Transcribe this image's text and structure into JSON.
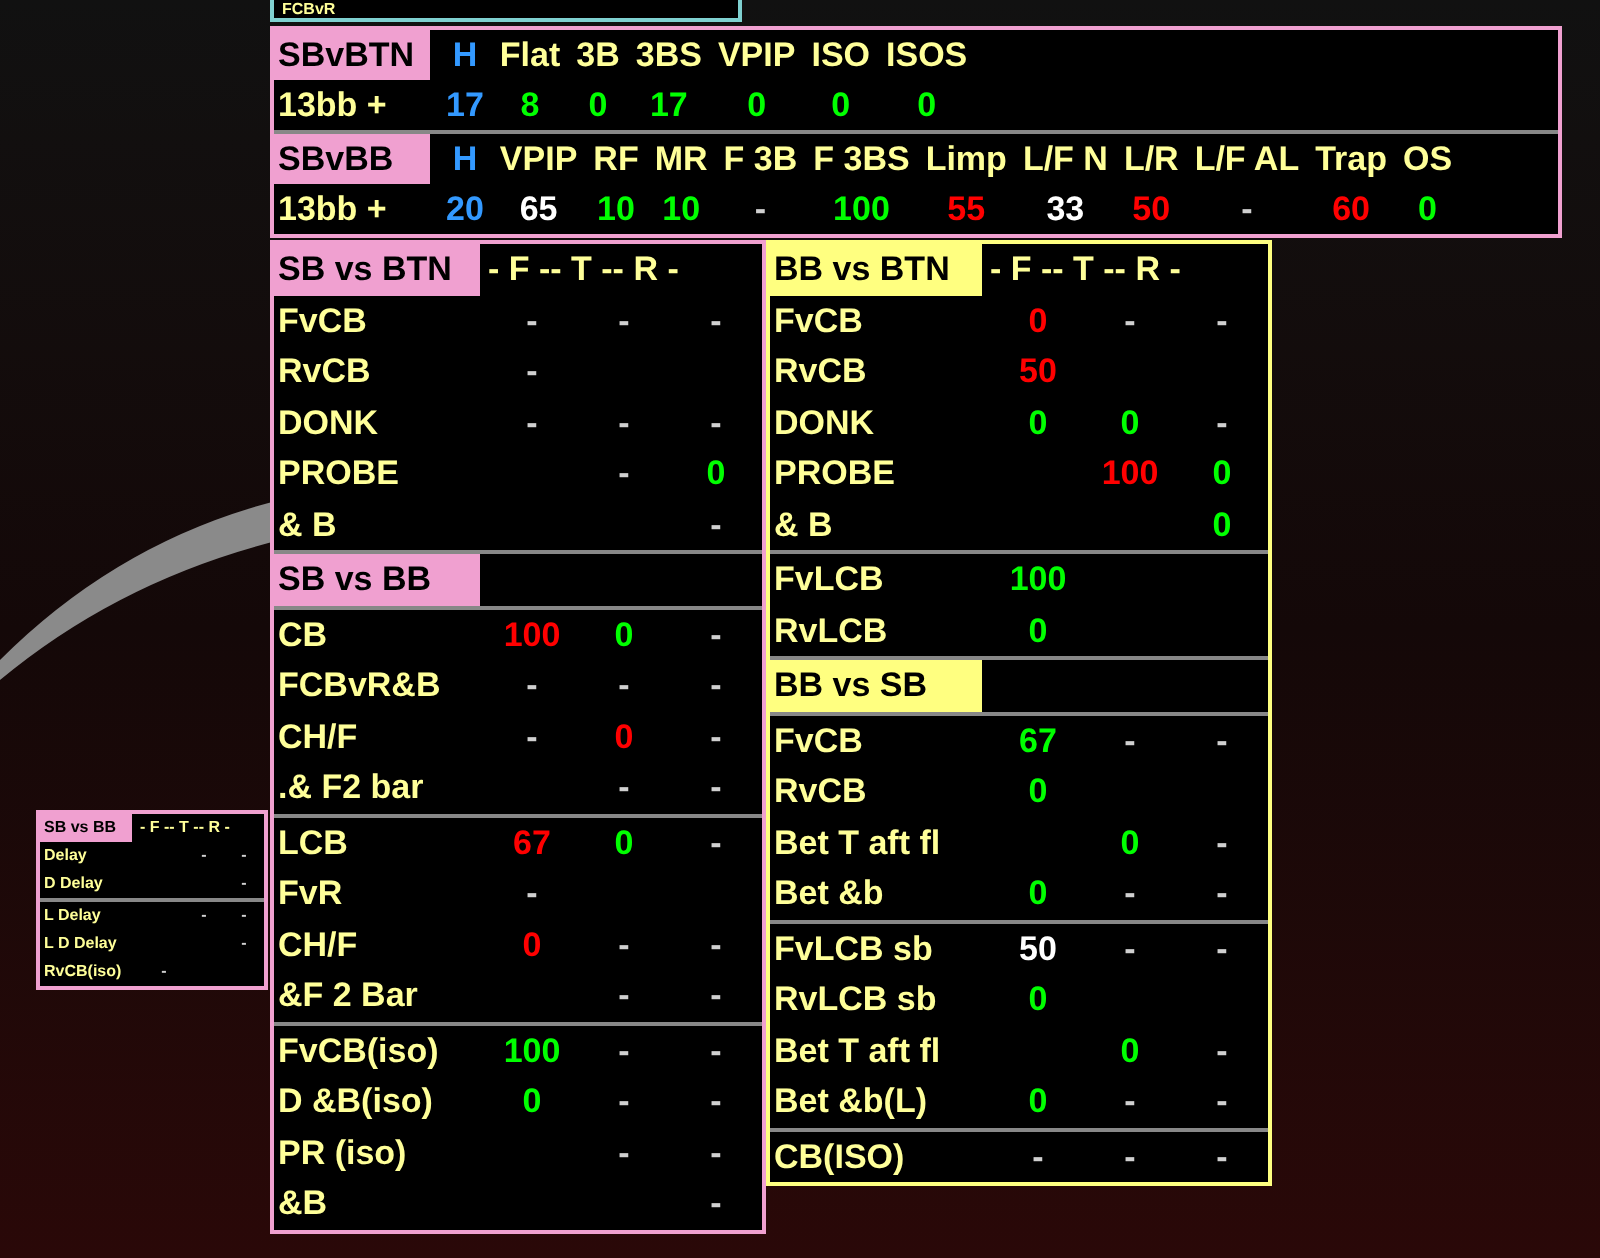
{
  "partial_panel": {
    "text": "FCBvR"
  },
  "top_hud": {
    "color": "#f0a0d0",
    "groups": [
      {
        "title": "SBvBTN",
        "row_label": "13bb +",
        "columns": [
          {
            "header": "H",
            "kind": "hands",
            "value": "17",
            "color": "#3399ff"
          },
          {
            "header": "Flat",
            "kind": "stat",
            "value": "8",
            "color": "#00ff00"
          },
          {
            "header": "3B",
            "kind": "stat",
            "value": "0",
            "color": "#00ff00"
          },
          {
            "header": "3BS",
            "kind": "stat",
            "value": "17",
            "color": "#00ff00"
          },
          {
            "header": "VPIP",
            "kind": "stat",
            "value": "0",
            "color": "#00ff00"
          },
          {
            "header": "ISO",
            "kind": "stat",
            "value": "0",
            "color": "#00ff00"
          },
          {
            "header": "ISOS",
            "kind": "stat",
            "value": "0",
            "color": "#00ff00"
          }
        ]
      },
      {
        "title": "SBvBB",
        "row_label": "13bb +",
        "columns": [
          {
            "header": "H",
            "kind": "hands",
            "value": "20",
            "color": "#3399ff"
          },
          {
            "header": "VPIP",
            "kind": "stat",
            "value": "65",
            "color": "#ffffff"
          },
          {
            "header": "RF",
            "kind": "stat",
            "value": "10",
            "color": "#00ff00"
          },
          {
            "header": "MR",
            "kind": "stat",
            "value": "10",
            "color": "#00ff00"
          },
          {
            "header": "F 3B",
            "kind": "stat",
            "value": "-",
            "color": "#d0d0d0"
          },
          {
            "header": "F 3BS",
            "kind": "stat",
            "value": "100",
            "color": "#00ff00"
          },
          {
            "header": "Limp",
            "kind": "stat",
            "value": "55",
            "color": "#ff0000"
          },
          {
            "header": "L/F N",
            "kind": "stat",
            "value": "33",
            "color": "#ffffff"
          },
          {
            "header": "L/R",
            "kind": "stat",
            "value": "50",
            "color": "#ff0000"
          },
          {
            "header": "L/F AL",
            "kind": "stat",
            "value": "-",
            "color": "#d0d0d0"
          },
          {
            "header": "Trap",
            "kind": "stat",
            "value": "60",
            "color": "#ff0000"
          },
          {
            "header": "OS",
            "kind": "stat",
            "value": "0",
            "color": "#00ff00"
          }
        ]
      }
    ]
  },
  "panels": [
    {
      "color": "#f0a0d0",
      "sections": [
        {
          "title": "SB vs BTN",
          "columns_header": "- F -- T -- R -",
          "rows": [
            {
              "label": "FvCB",
              "f": {
                "text": "-",
                "color": "#d0d0d0"
              },
              "t": {
                "text": "-",
                "color": "#d0d0d0"
              },
              "r": {
                "text": "-",
                "color": "#d0d0d0"
              }
            },
            {
              "label": "RvCB",
              "f": {
                "text": "-",
                "color": "#d0d0d0"
              }
            },
            {
              "label": "DONK",
              "f": {
                "text": "-",
                "color": "#d0d0d0"
              },
              "t": {
                "text": "-",
                "color": "#d0d0d0"
              },
              "r": {
                "text": "-",
                "color": "#d0d0d0"
              }
            },
            {
              "label": "PROBE",
              "t": {
                "text": "-",
                "color": "#d0d0d0"
              },
              "r": {
                "text": "0",
                "color": "#00ff00"
              }
            },
            {
              "label": "& B",
              "r": {
                "text": "-",
                "color": "#d0d0d0"
              }
            }
          ]
        },
        {
          "title": "SB vs BB",
          "rows": [
            {
              "label": "CB",
              "f": {
                "text": "100",
                "color": "#ff0000"
              },
              "t": {
                "text": "0",
                "color": "#00ff00"
              },
              "r": {
                "text": "-",
                "color": "#d0d0d0"
              }
            },
            {
              "label": "FCBvR&B",
              "f": {
                "text": "-",
                "color": "#d0d0d0"
              },
              "t": {
                "text": "-",
                "color": "#d0d0d0"
              },
              "r": {
                "text": "-",
                "color": "#d0d0d0"
              }
            },
            {
              "label": "CH/F",
              "f": {
                "text": "-",
                "color": "#d0d0d0"
              },
              "t": {
                "text": "0",
                "color": "#ff0000"
              },
              "r": {
                "text": "-",
                "color": "#d0d0d0"
              }
            },
            {
              "label": ".& F2 bar",
              "t": {
                "text": "-",
                "color": "#d0d0d0"
              },
              "r": {
                "text": "-",
                "color": "#d0d0d0"
              }
            }
          ]
        },
        {
          "rows": [
            {
              "label": "LCB",
              "f": {
                "text": "67",
                "color": "#ff0000"
              },
              "t": {
                "text": "0",
                "color": "#00ff00"
              },
              "r": {
                "text": "-",
                "color": "#d0d0d0"
              }
            },
            {
              "label": "FvR",
              "f": {
                "text": "-",
                "color": "#d0d0d0"
              }
            },
            {
              "label": "CH/F",
              "f": {
                "text": "0",
                "color": "#ff0000"
              },
              "t": {
                "text": "-",
                "color": "#d0d0d0"
              },
              "r": {
                "text": "-",
                "color": "#d0d0d0"
              }
            },
            {
              "label": "&F 2 Bar",
              "t": {
                "text": "-",
                "color": "#d0d0d0"
              },
              "r": {
                "text": "-",
                "color": "#d0d0d0"
              }
            }
          ]
        },
        {
          "rows": [
            {
              "label": "FvCB(iso)",
              "f": {
                "text": "100",
                "color": "#00ff00"
              },
              "t": {
                "text": "-",
                "color": "#d0d0d0"
              },
              "r": {
                "text": "-",
                "color": "#d0d0d0"
              }
            },
            {
              "label": "D &B(iso)",
              "f": {
                "text": "0",
                "color": "#00ff00"
              },
              "t": {
                "text": "-",
                "color": "#d0d0d0"
              },
              "r": {
                "text": "-",
                "color": "#d0d0d0"
              }
            },
            {
              "label": "PR (iso)",
              "t": {
                "text": "-",
                "color": "#d0d0d0"
              },
              "r": {
                "text": "-",
                "color": "#d0d0d0"
              }
            },
            {
              "label": "&B",
              "r": {
                "text": "-",
                "color": "#d0d0d0"
              }
            }
          ]
        }
      ]
    },
    {
      "color": "#ffff80",
      "sections": [
        {
          "title": "BB vs BTN",
          "columns_header": "- F -- T -- R -",
          "rows": [
            {
              "label": "FvCB",
              "f": {
                "text": "0",
                "color": "#ff0000"
              },
              "t": {
                "text": "-",
                "color": "#d0d0d0"
              },
              "r": {
                "text": "-",
                "color": "#d0d0d0"
              }
            },
            {
              "label": "RvCB",
              "f": {
                "text": "50",
                "color": "#ff0000"
              }
            },
            {
              "label": "DONK",
              "f": {
                "text": "0",
                "color": "#00ff00"
              },
              "t": {
                "text": "0",
                "color": "#00ff00"
              },
              "r": {
                "text": "-",
                "color": "#d0d0d0"
              }
            },
            {
              "label": "PROBE",
              "t": {
                "text": "100",
                "color": "#ff0000"
              },
              "r": {
                "text": "0",
                "color": "#00ff00"
              }
            },
            {
              "label": "& B",
              "r": {
                "text": "0",
                "color": "#00ff00"
              }
            }
          ]
        },
        {
          "rows": [
            {
              "label": "FvLCB",
              "f": {
                "text": "100",
                "color": "#00ff00"
              }
            },
            {
              "label": "RvLCB",
              "f": {
                "text": "0",
                "color": "#00ff00"
              }
            }
          ]
        },
        {
          "title": "BB vs SB",
          "rows": [
            {
              "label": "FvCB",
              "f": {
                "text": "67",
                "color": "#00ff00"
              },
              "t": {
                "text": "-",
                "color": "#d0d0d0"
              },
              "r": {
                "text": "-",
                "color": "#d0d0d0"
              }
            },
            {
              "label": "RvCB",
              "f": {
                "text": "0",
                "color": "#00ff00"
              }
            },
            {
              "label": "Bet T aft fl",
              "t": {
                "text": "0",
                "color": "#00ff00"
              },
              "r": {
                "text": "-",
                "color": "#d0d0d0"
              }
            },
            {
              "label": "Bet &b",
              "f": {
                "text": "0",
                "color": "#00ff00"
              },
              "t": {
                "text": "-",
                "color": "#d0d0d0"
              },
              "r": {
                "text": "-",
                "color": "#d0d0d0"
              }
            }
          ]
        },
        {
          "rows": [
            {
              "label": "FvLCB sb",
              "f": {
                "text": "50",
                "color": "#ffffff"
              },
              "t": {
                "text": "-",
                "color": "#d0d0d0"
              },
              "r": {
                "text": "-",
                "color": "#d0d0d0"
              }
            },
            {
              "label": "RvLCB sb",
              "f": {
                "text": "0",
                "color": "#00ff00"
              }
            },
            {
              "label": "Bet T aft fl",
              "t": {
                "text": "0",
                "color": "#00ff00"
              },
              "r": {
                "text": "-",
                "color": "#d0d0d0"
              }
            },
            {
              "label": "Bet &b(L)",
              "f": {
                "text": "0",
                "color": "#00ff00"
              },
              "t": {
                "text": "-",
                "color": "#d0d0d0"
              },
              "r": {
                "text": "-",
                "color": "#d0d0d0"
              }
            }
          ]
        },
        {
          "rows": [
            {
              "label": "CB(ISO)",
              "f": {
                "text": "-",
                "color": "#d0d0d0"
              },
              "t": {
                "text": "-",
                "color": "#d0d0d0"
              },
              "r": {
                "text": "-",
                "color": "#d0d0d0"
              }
            }
          ]
        }
      ]
    }
  ],
  "mini_panel": {
    "color": "#f0a0d0",
    "sections": [
      {
        "title": "SB vs BB",
        "columns_header": "- F -- T -- R -",
        "rows": [
          {
            "label": "Delay",
            "t": {
              "text": "-",
              "color": "#d0d0d0"
            },
            "r": {
              "text": "-",
              "color": "#d0d0d0"
            }
          },
          {
            "label": "D Delay",
            "r": {
              "text": "-",
              "color": "#d0d0d0"
            }
          }
        ]
      },
      {
        "rows": [
          {
            "label": "L Delay",
            "t": {
              "text": "-",
              "color": "#d0d0d0"
            },
            "r": {
              "text": "-",
              "color": "#d0d0d0"
            }
          },
          {
            "label": "L D Delay",
            "r": {
              "text": "-",
              "color": "#d0d0d0"
            }
          },
          {
            "label": "RvCB(iso)",
            "f": {
              "text": "-",
              "color": "#d0d0d0"
            }
          }
        ]
      }
    ]
  }
}
